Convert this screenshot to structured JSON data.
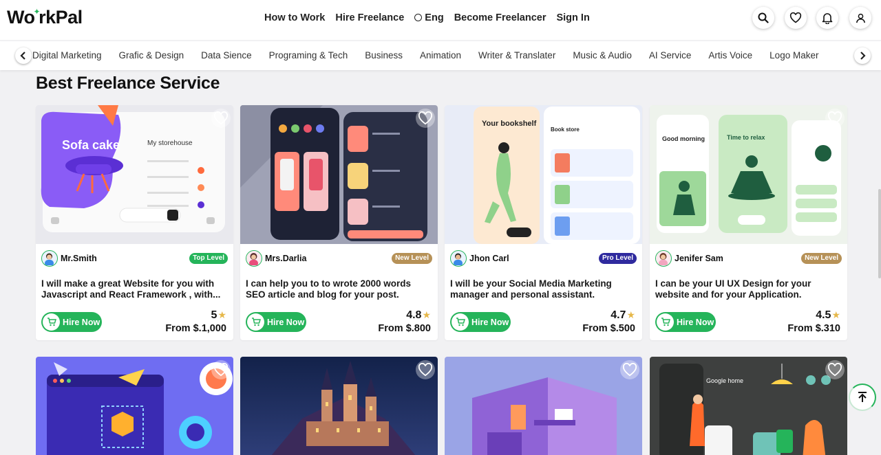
{
  "brand": {
    "logo": "WorkPal"
  },
  "nav": {
    "how_to_work": "How to Work",
    "hire_freelance": "Hire Freelance",
    "language": "Eng",
    "become_freelancer": "Become Freelancer",
    "sign_in": "Sign In"
  },
  "header_icons": [
    "search-icon",
    "heart-icon",
    "bell-icon",
    "user-icon"
  ],
  "categories": [
    "Digital Marketing",
    "Grafic & Design",
    "Data Sience",
    "Programing & Tech",
    "Business",
    "Animation",
    "Writer & Translater",
    "Music & Audio",
    "AI Service",
    "Artis Voice",
    "Logo Maker"
  ],
  "section": {
    "title": "Best Freelance Service"
  },
  "services": [
    {
      "seller": "Mr.Smith",
      "level": "Top Level",
      "level_color": "#25b45a",
      "description": "I will make a great Website for you with Javascript and React Framework , with...",
      "hire_label": "Hire Now",
      "rating": "5",
      "price": "From $.1,000"
    },
    {
      "seller": "Mrs.Darlia",
      "level": "New Level",
      "level_color": "#b69157",
      "description": "I can help you to to wrote 2000 words SEO article and blog for your post.",
      "hire_label": "Hire Now",
      "rating": "4.8",
      "price": "From $.800"
    },
    {
      "seller": "Jhon Carl",
      "level": "Pro Level",
      "level_color": "#2f2a9e",
      "description": "I will be your Social Media Marketing manager and personal assistant.",
      "hire_label": "Hire Now",
      "rating": "4.7",
      "price": "From $.500"
    },
    {
      "seller": "Jenifer Sam",
      "level": "New Level",
      "level_color": "#b69157",
      "description": "I can be your UI UX Design for your website and for your Application.",
      "hire_label": "Hire Now",
      "rating": "4.5",
      "price": "From $.310"
    }
  ],
  "thumb_texts": {
    "c1_big": "Sofa cake",
    "c1_small": "My storehouse",
    "c3_left": "Your bookshelf",
    "c3_right": "Book store",
    "c4_left": "Good morning",
    "c4_right": "Time to relax",
    "r2_4": "Google home"
  },
  "colors": {
    "accent": "#25b45a",
    "star": "#e6b84a",
    "pro": "#2f2a9e",
    "new": "#b69157"
  }
}
